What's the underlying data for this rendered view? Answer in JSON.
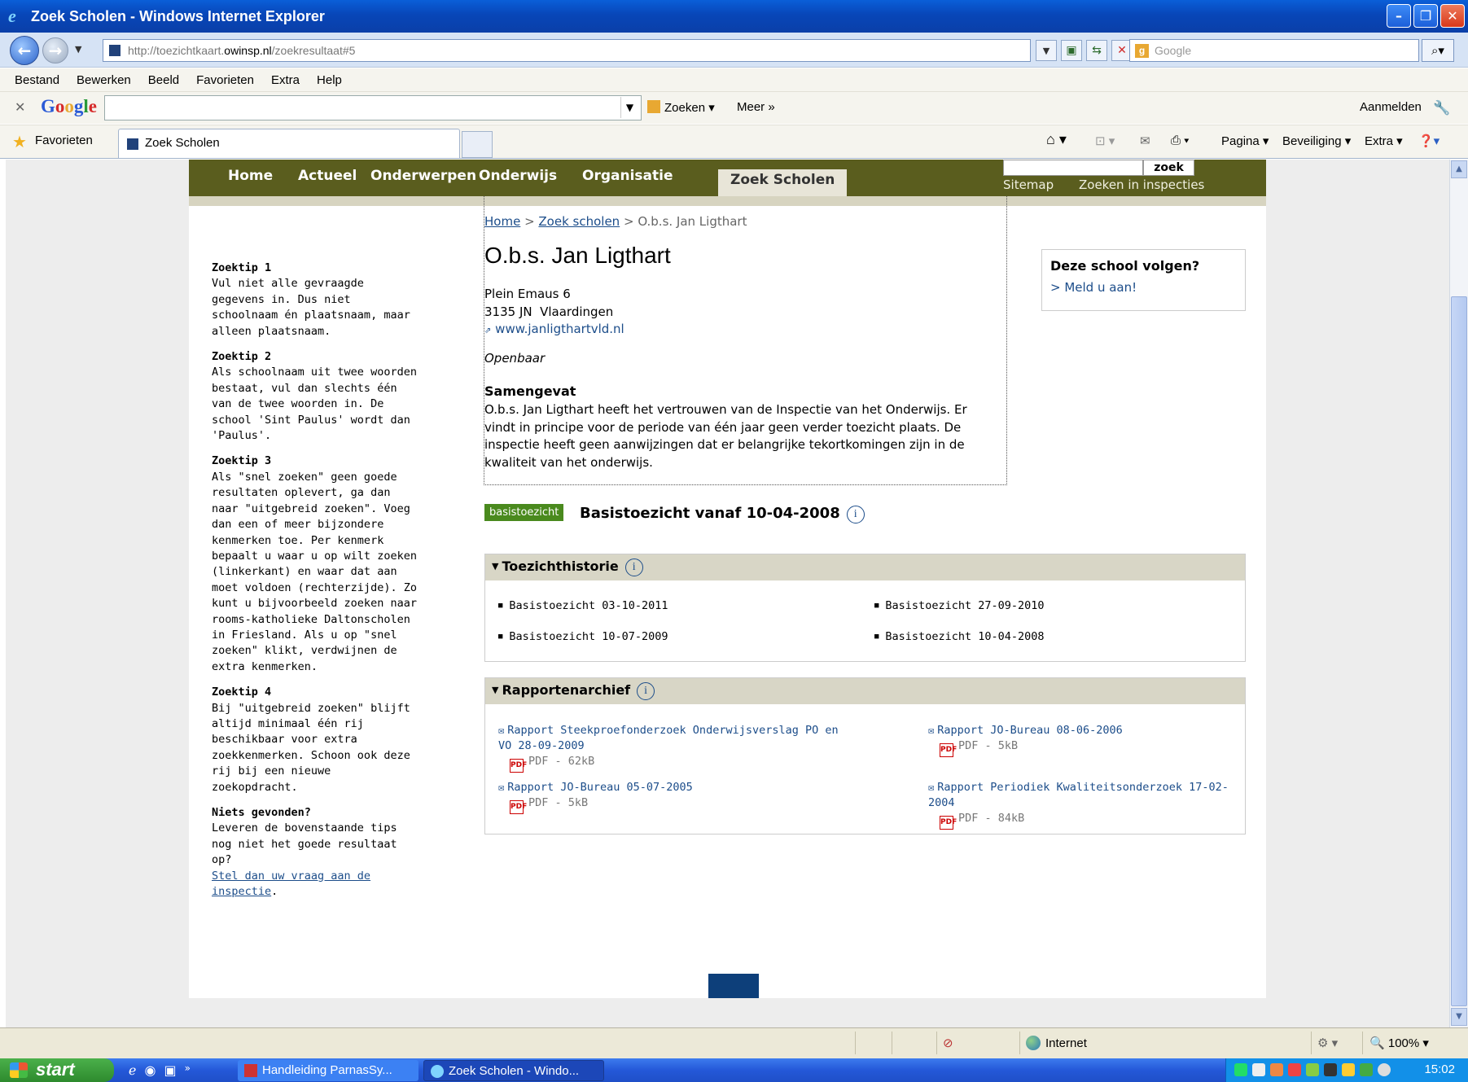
{
  "window": {
    "title": "Zoek Scholen - Windows Internet Explorer",
    "url_prefix": "http://toezichtkaart.",
    "url_domain": "owinsp.nl",
    "url_suffix": "/zoekresultaat#5",
    "search_placeholder": "Google"
  },
  "menu": [
    "Bestand",
    "Bewerken",
    "Beeld",
    "Favorieten",
    "Extra",
    "Help"
  ],
  "google_bar": {
    "search_label": "Zoeken",
    "more_label": "Meer »",
    "signin_label": "Aanmelden"
  },
  "favorites_bar": {
    "favorites_label": "Favorieten",
    "tab_title": "Zoek Scholen",
    "commands": [
      "Pagina",
      "Beveiliging",
      "Extra"
    ]
  },
  "site_nav": {
    "items": [
      "Home",
      "Actueel",
      "Onderwerpen",
      "Onderwijs",
      "Organisatie",
      "Zoek Scholen"
    ],
    "active_index": 5,
    "search_button": "zoek",
    "sitemap": "Sitemap",
    "search_inspections": "Zoeken in inspecties"
  },
  "tips": [
    {
      "title": "Zoektip 1",
      "text": "Vul niet alle gevraagde gegevens in. Dus niet schoolnaam én plaatsnaam, maar alleen plaatsnaam."
    },
    {
      "title": "Zoektip 2",
      "text": "Als schoolnaam uit twee woorden bestaat, vul dan slechts één van de twee woorden in. De school 'Sint Paulus' wordt dan 'Paulus'."
    },
    {
      "title": "Zoektip 3",
      "text": "Als \"snel zoeken\" geen goede resultaten oplevert, ga dan naar \"uitgebreid zoeken\". Voeg dan een of meer bijzondere kenmerken toe. Per kenmerk bepaalt u waar u op wilt zoeken (linkerkant) en waar dat aan moet voldoen (rechterzijde). Zo kunt u bijvoorbeeld zoeken naar rooms-katholieke Daltonscholen in Friesland. Als u op \"snel zoeken\" klikt, verdwijnen de extra kenmerken."
    },
    {
      "title": "Zoektip 4",
      "text": "Bij \"uitgebreid zoeken\" blijft altijd minimaal één rij beschikbaar voor extra zoekkenmerken. Schoon ook deze rij bij een nieuwe zoekopdracht."
    },
    {
      "title": "Niets gevonden?",
      "text": "Leveren de bovenstaande tips nog niet het goede resultaat op?"
    }
  ],
  "tips_link": "Stel dan uw vraag aan de inspectie",
  "breadcrumb": {
    "home": "Home",
    "search": "Zoek scholen",
    "current": "O.b.s. Jan Ligthart"
  },
  "school": {
    "name": "O.b.s. Jan Ligthart",
    "street": "Plein Emaus 6",
    "city": "3135 JN  Vlaardingen",
    "website": "www.janligthartvld.nl",
    "type": "Openbaar",
    "summary_title": "Samengevat",
    "summary": "O.b.s. Jan Ligthart heeft het vertrouwen van de Inspectie van het Onderwijs. Er vindt in principe voor de periode van één jaar geen verder toezicht plaats. De inspectie heeft geen aanwijzingen dat er belangrijke tekortkomingen zijn in de kwaliteit van het onderwijs."
  },
  "follow": {
    "title": "Deze school volgen?",
    "link": "> Meld u aan!"
  },
  "oversight": {
    "badge": "basistoezicht",
    "title": "Basistoezicht vanaf 10-04-2008"
  },
  "history": {
    "title": "Toezichthistorie",
    "items": [
      "Basistoezicht 03-10-2011",
      "Basistoezicht 27-09-2010",
      "Basistoezicht 10-07-2009",
      "Basistoezicht 10-04-2008"
    ]
  },
  "archive": {
    "title": "Rapportenarchief",
    "reports": [
      {
        "title": "Rapport Steekproefonderzoek Onderwijsverslag PO en VO 28-09-2009",
        "file": "PDF - 62kB"
      },
      {
        "title": "Rapport JO-Bureau 08-06-2006",
        "file": "PDF - 5kB"
      },
      {
        "title": "Rapport JO-Bureau 05-07-2005",
        "file": "PDF - 5kB"
      },
      {
        "title": "Rapport Periodiek Kwaliteitsonderzoek 17-02-2004",
        "file": "PDF - 84kB"
      }
    ]
  },
  "status_bar": {
    "zone": "Internet",
    "zoom": "100%"
  },
  "taskbar": {
    "start": "start",
    "tasks": [
      "Handleiding ParnasSy...",
      "Zoek Scholen - Windo..."
    ],
    "clock": "15:02"
  }
}
